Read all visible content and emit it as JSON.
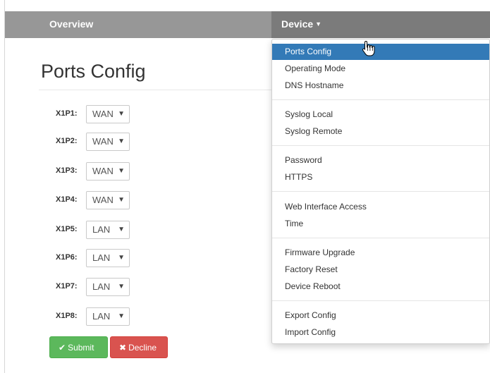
{
  "nav": {
    "overview": "Overview",
    "device": "Device"
  },
  "page": {
    "title": "Ports Config"
  },
  "ports": [
    {
      "label": "X1P1:",
      "value": "WAN"
    },
    {
      "label": "X1P2:",
      "value": "WAN"
    },
    {
      "label": "X1P3:",
      "value": "WAN"
    },
    {
      "label": "X1P4:",
      "value": "WAN"
    },
    {
      "label": "X1P5:",
      "value": "LAN"
    },
    {
      "label": "X1P6:",
      "value": "LAN"
    },
    {
      "label": "X1P7:",
      "value": "LAN"
    },
    {
      "label": "X1P8:",
      "value": "LAN"
    }
  ],
  "buttons": {
    "submit": "Submit",
    "decline": "Decline"
  },
  "menu": {
    "items": [
      {
        "label": "Ports Config"
      },
      {
        "label": "Operating Mode"
      },
      {
        "label": "DNS Hostname"
      },
      {
        "label": "Syslog Local"
      },
      {
        "label": "Syslog Remote"
      },
      {
        "label": "Password"
      },
      {
        "label": "HTTPS"
      },
      {
        "label": "Web Interface Access"
      },
      {
        "label": "Time"
      },
      {
        "label": "Firmware Upgrade"
      },
      {
        "label": "Factory Reset"
      },
      {
        "label": "Device Reboot"
      },
      {
        "label": "Export Config"
      },
      {
        "label": "Import Config"
      }
    ],
    "active_index": 0
  },
  "colors": {
    "navbar": "#979797",
    "navbar_active": "#7b7b7b",
    "menu_highlight": "#337ab7",
    "submit": "#5cb85c",
    "decline": "#d9534f"
  },
  "icons": {
    "submit": "check-icon",
    "decline": "x-icon",
    "select": "chevron-down-icon",
    "cursor": "hand-pointer-icon"
  }
}
